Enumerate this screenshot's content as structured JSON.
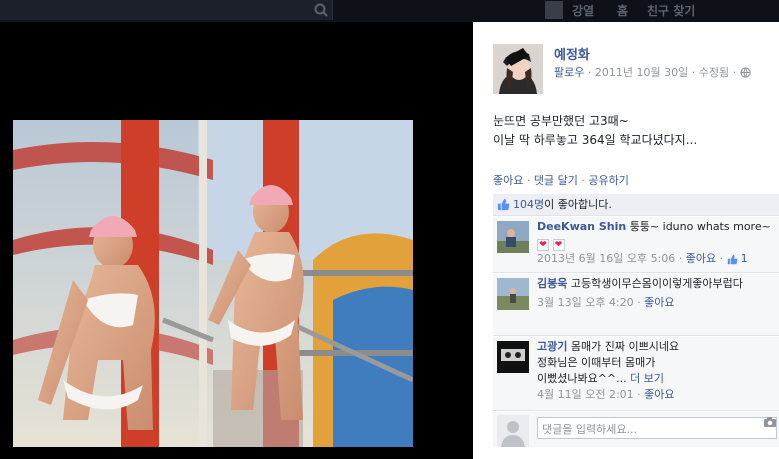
{
  "topbar": {
    "links": [
      "강열",
      "홈",
      "친구 찾기"
    ]
  },
  "post": {
    "author": "예정화",
    "follow": "팔로우",
    "date": "2011년 10월 30일",
    "edited": "수정됨",
    "text_line1": "눈뜨면 공부만했던 고3때~",
    "text_line2": "이날 딱 하루놓고 364일 학교다녔다지...",
    "action_like": "좋아요",
    "action_comment": "댓글 달기",
    "action_share": "공유하기",
    "likes_count": "104명",
    "likes_suffix": "이 좋아합니다.",
    "icons": {
      "privacy": "globe-icon",
      "like": "thumbs-up-icon",
      "search": "search-icon",
      "camera": "camera-icon"
    }
  },
  "comments": [
    {
      "name": "DeeKwan Shin",
      "text": "퉁퉁~ iduno whats more~",
      "time": "2013년 6월 16일 오후 5:06",
      "like": "좋아요",
      "like_count": "1"
    },
    {
      "name": "김봉욱",
      "text": "고등학생이무슨몸이이렇게좋아부럽다",
      "time": "3월 13일 오후 4:20",
      "like": "좋아요"
    },
    {
      "name": "고광기",
      "text_line1": "몸매가 진짜 이쁘시네요",
      "text_line2": "정화님은 이때부터 몸매가",
      "text_line3": "이뻤셨나봐요^^...",
      "more": "더 보기",
      "time": "4월 11일 오전 2:01",
      "like": "좋아요"
    }
  ],
  "composer": {
    "placeholder": "댓글을 입력하세요..."
  }
}
